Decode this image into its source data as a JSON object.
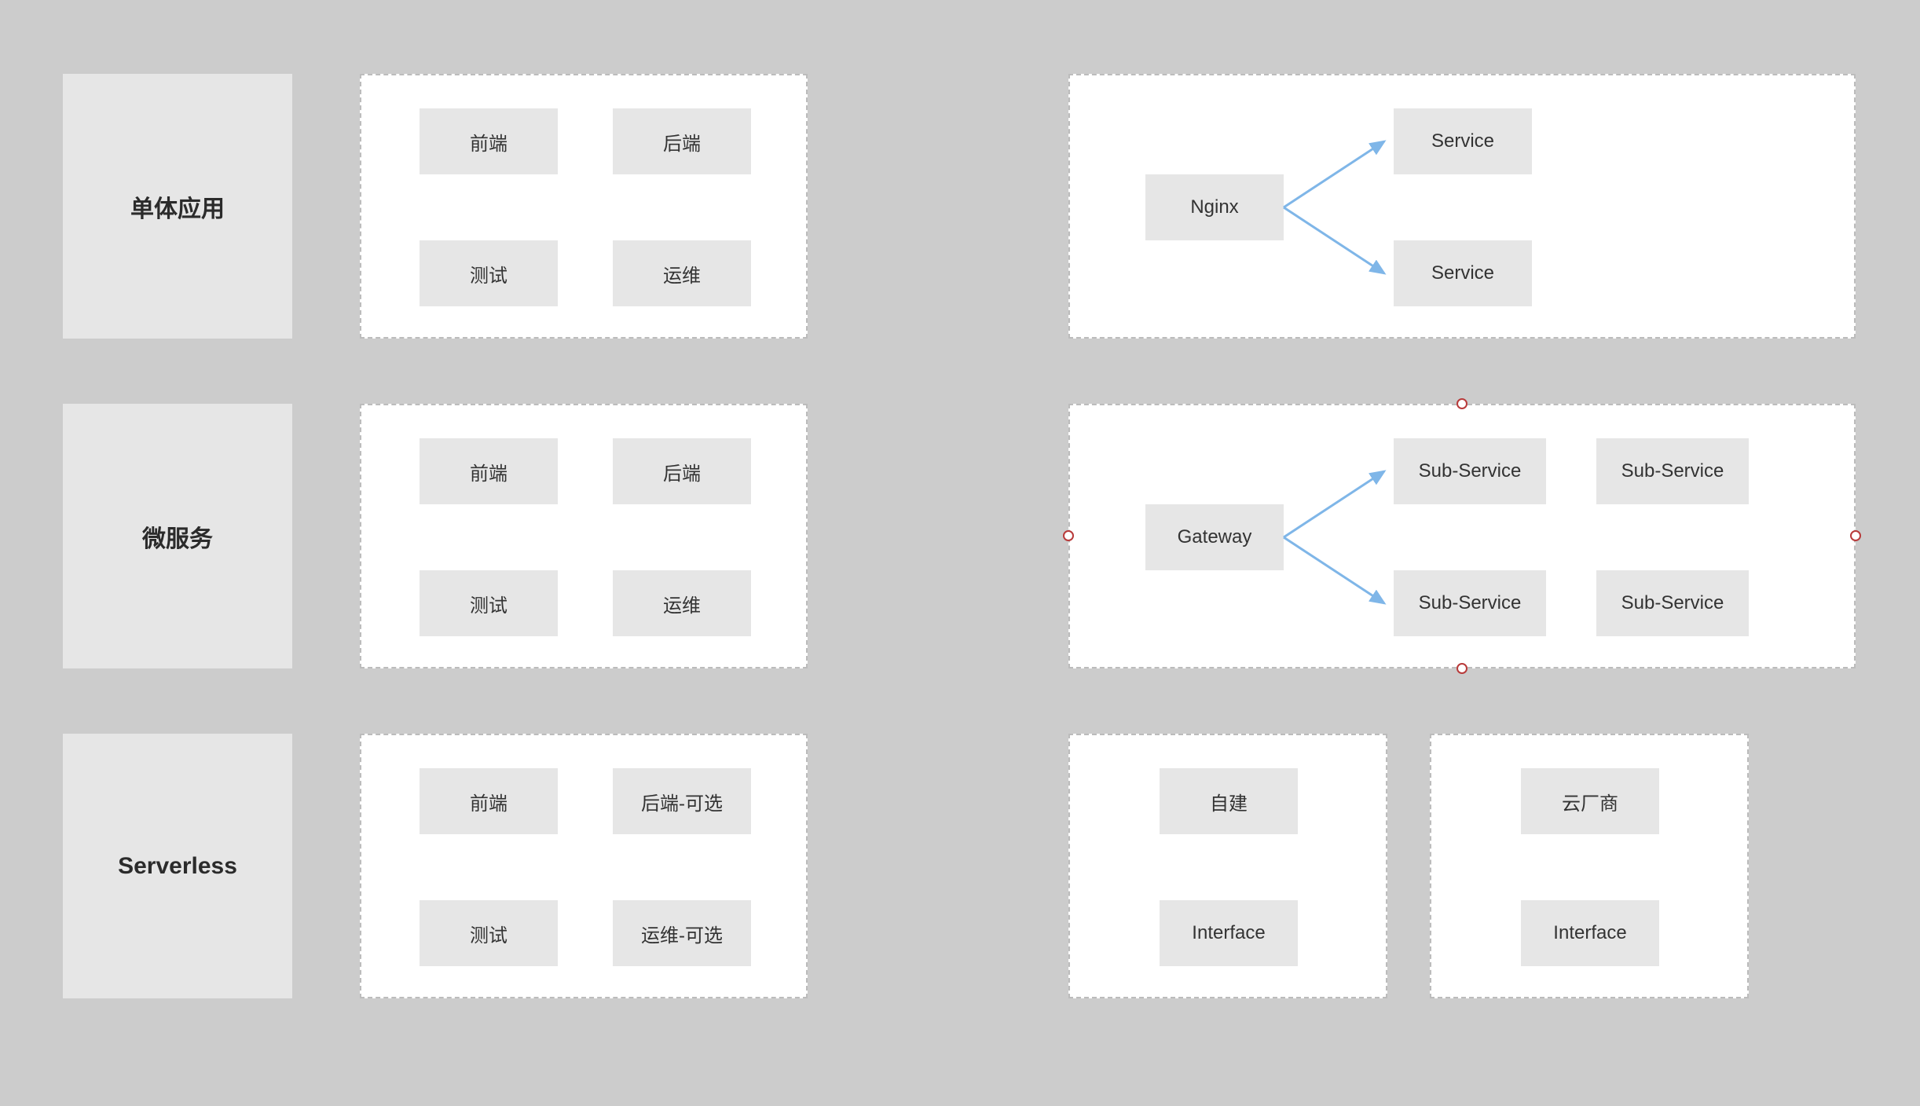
{
  "rows": [
    {
      "label": "单体应用"
    },
    {
      "label": "微服务"
    },
    {
      "label": "Serverless"
    }
  ],
  "panel_a1": {
    "nodes": [
      "前端",
      "后端",
      "测试",
      "运维"
    ]
  },
  "panel_a2": {
    "root": "Nginx",
    "children": [
      "Service",
      "Service"
    ]
  },
  "panel_b1": {
    "nodes": [
      "前端",
      "后端",
      "测试",
      "运维"
    ]
  },
  "panel_b2": {
    "root": "Gateway",
    "children": [
      "Sub-Service",
      "Sub-Service",
      "Sub-Service",
      "Sub-Service"
    ]
  },
  "panel_c1": {
    "nodes": [
      "前端",
      "后端-可选",
      "测试",
      "运维-可选"
    ]
  },
  "panel_c2": {
    "nodes": [
      "自建",
      "Interface"
    ]
  },
  "panel_c3": {
    "nodes": [
      "云厂商",
      "Interface"
    ]
  },
  "arrow_color": "#7fb6e8"
}
